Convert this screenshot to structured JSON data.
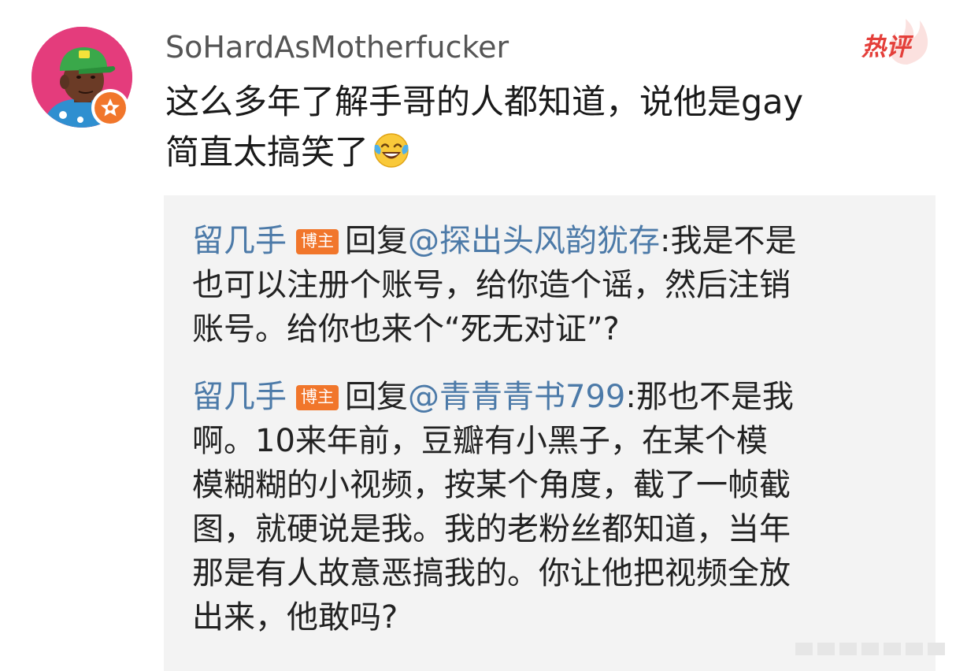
{
  "post": {
    "username": "SoHardAsMotherfucker",
    "hot_tag": "热评",
    "comment_lines": [
      "这么多年了解手哥的人都知道，说他是gay",
      "简直太搞笑了"
    ],
    "emoji": "laughing-crying-emoji"
  },
  "replies": [
    {
      "user": "留几手",
      "badge": "博主",
      "reply_word": "回复",
      "mention": "@探出头风韵犹存",
      "line1_text": ":我是不是",
      "lines": [
        "也可以注册个账号，给你造个谣，然后注销",
        "账号。给你也来个“死无对证”?"
      ]
    },
    {
      "user": "留几手",
      "badge": "博主",
      "reply_word": "回复",
      "mention": "@青青青书799",
      "line1_text": ":那也不是我",
      "lines": [
        "啊。10来年前，豆瓣有小黑子，在某个模",
        "模糊糊的小视频，按某个角度，截了一帧截",
        "图，就硬说是我。我的老粉丝都知道，当年",
        "那是有人故意恶搞我的。你让他把视频全放",
        "出来，他敢吗?"
      ]
    }
  ],
  "colors": {
    "link": "#4c7aa8",
    "badge": "#f1762b",
    "hot": "#e43f3a",
    "reply_bg": "#f3f3f3"
  }
}
